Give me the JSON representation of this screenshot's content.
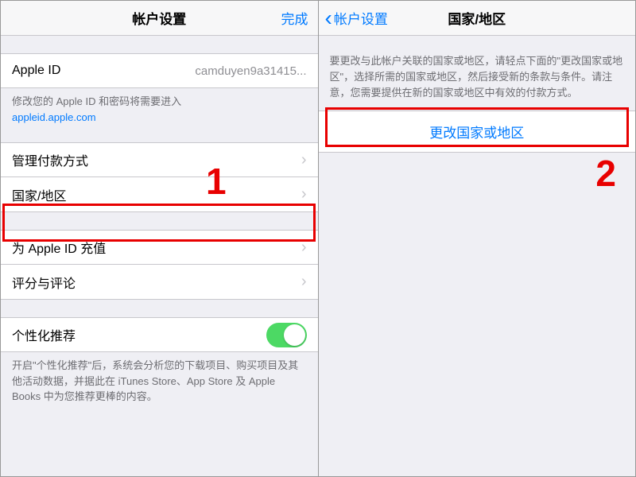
{
  "left": {
    "nav_title": "帐户设置",
    "done": "完成",
    "apple_id_label": "Apple ID",
    "apple_id_value": "camduyen9a31415...",
    "appleid_note_prefix": "修改您的 Apple ID 和密码将需要进入 ",
    "appleid_link": "appleid.apple.com",
    "manage_payment": "管理付款方式",
    "country_region": "国家/地区",
    "add_funds": "为 Apple ID 充值",
    "ratings_reviews": "评分与评论",
    "personalized": "个性化推荐",
    "personalized_note": "开启\"个性化推荐\"后，系统会分析您的下载项目、购买项目及其他活动数据，并据此在 iTunes Store、App Store 及 Apple Books 中为您推荐更棒的内容。"
  },
  "right": {
    "back_label": "帐户设置",
    "nav_title": "国家/地区",
    "description": "要更改与此帐户关联的国家或地区，请轻点下面的\"更改国家或地区\"，选择所需的国家或地区，然后接受新的条款与条件。请注意，您需要提供在新的国家或地区中有效的付款方式。",
    "change_button": "更改国家或地区"
  },
  "annotations": {
    "step1": "1",
    "step2": "2"
  }
}
